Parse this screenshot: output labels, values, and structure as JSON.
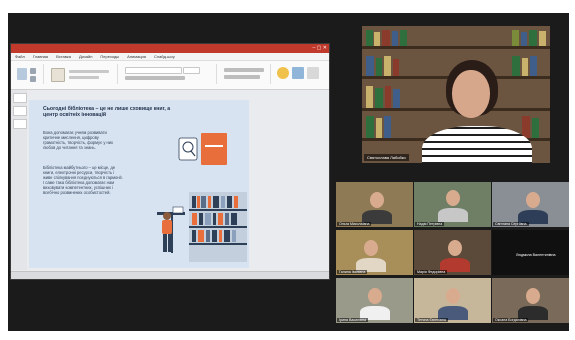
{
  "ppt": {
    "tabs": [
      "Файл",
      "Главная",
      "Вставка",
      "Дизайн",
      "Переходы",
      "Анимация",
      "Слайд-шоу",
      "Рецензирование",
      "Вид"
    ]
  },
  "slide": {
    "title": "Сьогодні бібліотека – це не лише сховище книг, а центр освітніх інновацій",
    "paragraph1": "Вона допомагає учням розвивати критичне мислення, цифрову грамотність, творчість, формує у них любов до читання та знань.",
    "paragraph2": "Бібліотека майбутнього – це місце, де книги, електронні ресурси, творчість і живе спілкування поєднуються в гармонії. І саме така бібліотека допомагає нам виховувати компетентних, успішних і всебічно розвинених особистостей."
  },
  "speaker": {
    "name": "Святослава Лабойко"
  },
  "participants": [
    {
      "name": "Ольга Миколаївна"
    },
    {
      "name": "Надія Петрівна"
    },
    {
      "name": "Світлана Сергіївна"
    },
    {
      "name": "Галина Іванівна"
    },
    {
      "name": "Марія Федорівна"
    },
    {
      "name": "Людмила Валентинівна"
    },
    {
      "name": "Ірина Василівна"
    },
    {
      "name": "Тетяна Євгенівна"
    },
    {
      "name": "Оксана Богданівна"
    }
  ],
  "colors": {
    "app_bg": "#1b1b1b",
    "slide_bg": "#d7e3f0",
    "ppt_titlebar": "#c0392b",
    "accent_orange": "#e86f3c"
  }
}
